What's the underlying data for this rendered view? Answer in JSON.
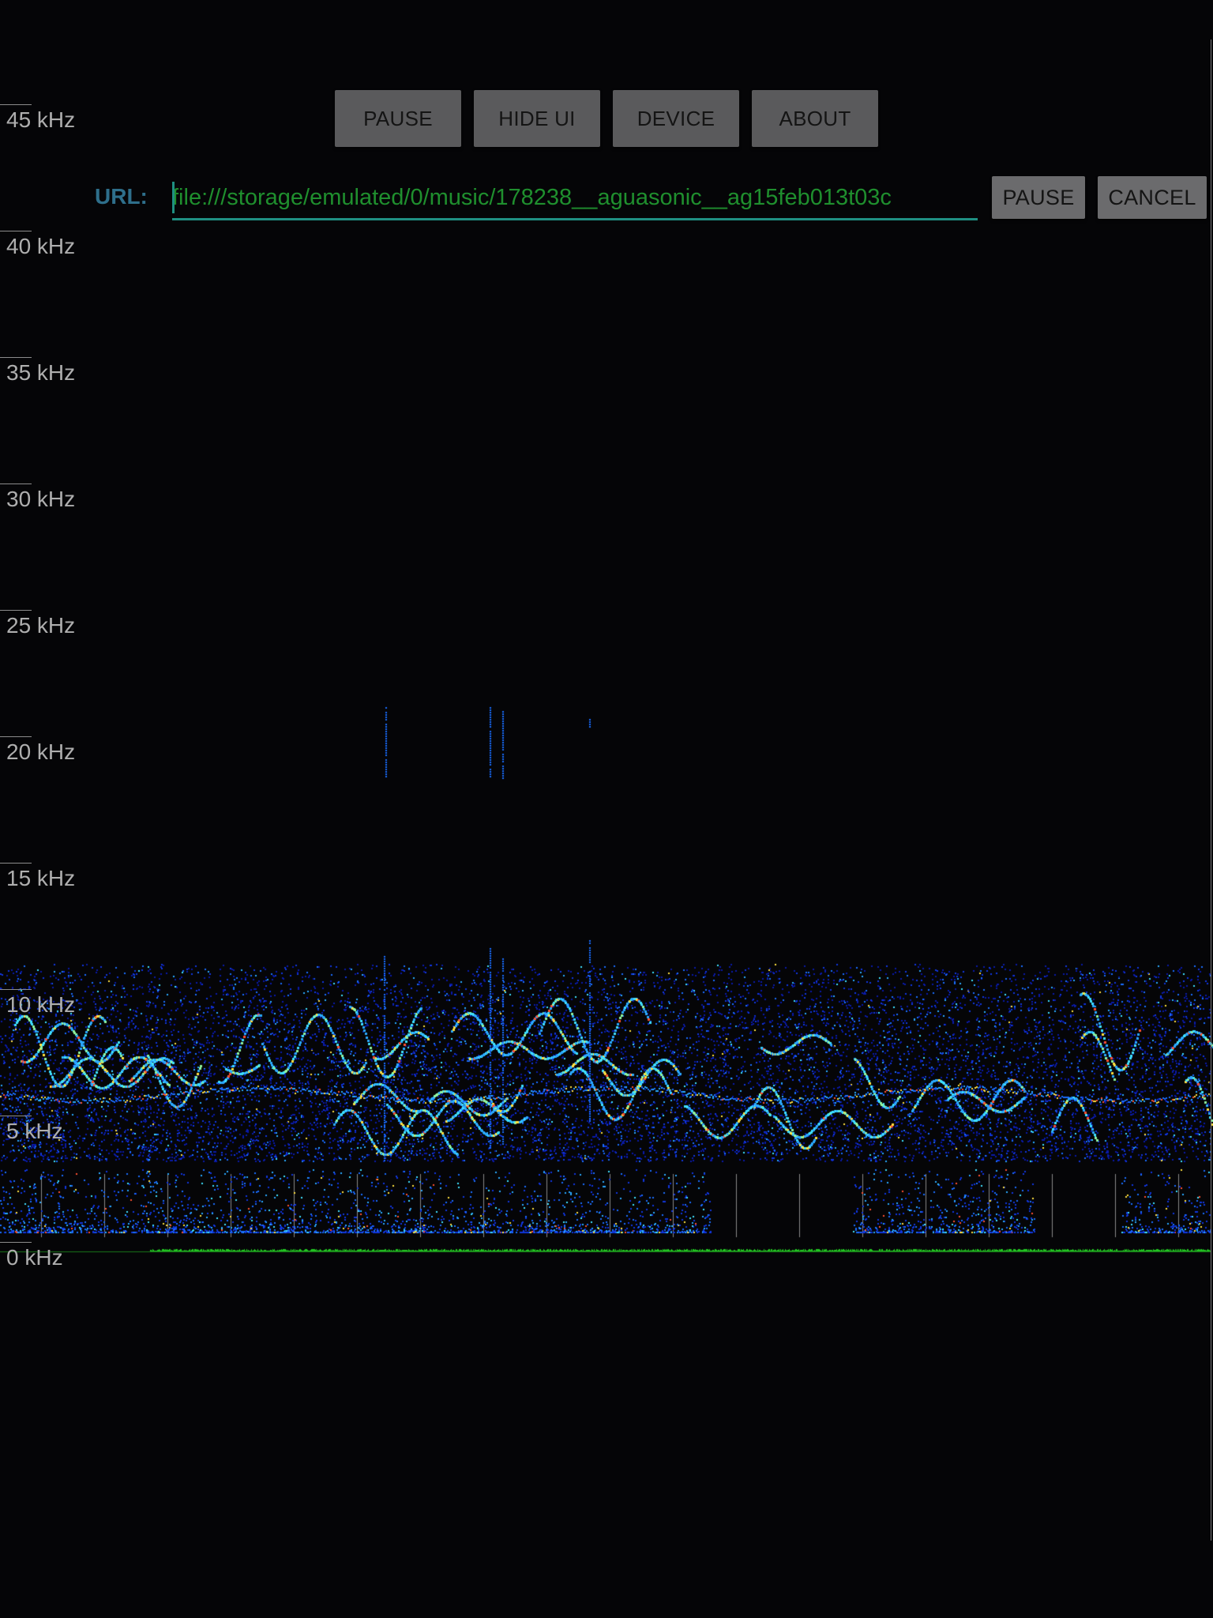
{
  "toolbar": {
    "pause_label": "PAUSE",
    "hide_ui_label": "HIDE UI",
    "device_label": "DEVICE",
    "about_label": "ABOUT"
  },
  "url_bar": {
    "label": "URL:",
    "value": "file:///storage/emulated/0/music/178238__aguasonic__ag15feb013t03c",
    "pause_label": "PAUSE",
    "cancel_label": "CANCEL"
  },
  "frequency_axis": {
    "labels": [
      "45 kHz",
      "40 kHz",
      "35 kHz",
      "30 kHz",
      "25 kHz",
      "20 kHz",
      "15 kHz",
      "10 kHz",
      "5 kHz",
      "0 kHz"
    ]
  },
  "colors": {
    "background": "#050507",
    "url_label": "#2e6f8b",
    "url_text": "#1f8f2e",
    "url_underline": "#1f8f82",
    "waveform": "#22c522"
  }
}
